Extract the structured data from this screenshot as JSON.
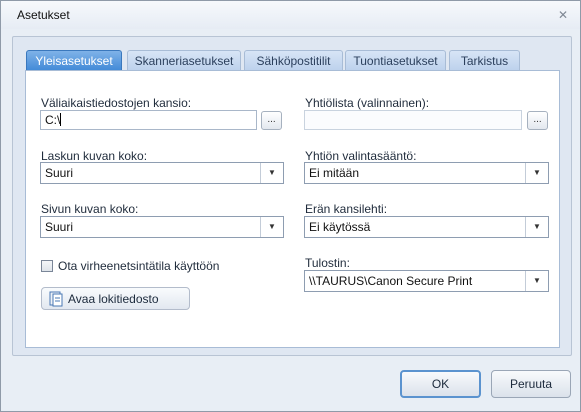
{
  "window": {
    "title": "Asetukset",
    "close_glyph": "✕"
  },
  "tabs": [
    {
      "label": "Yleisasetukset",
      "active": true
    },
    {
      "label": "Skanneriasetukset",
      "active": false
    },
    {
      "label": "Sähköpostitilit",
      "active": false
    },
    {
      "label": "Tuontiasetukset",
      "active": false
    },
    {
      "label": "Tarkistus",
      "active": false
    }
  ],
  "left": {
    "temp_folder_label": "Väliaikaistiedostojen kansio:",
    "temp_folder_value": "C:\\",
    "browse_label": "...",
    "invoice_image_size_label": "Laskun kuvan koko:",
    "invoice_image_size_value": "Suuri",
    "page_image_size_label": "Sivun kuvan koko:",
    "page_image_size_value": "Suuri",
    "debug_mode_label": "Ota virheenetsintätila käyttöön",
    "debug_mode_checked": false,
    "open_log_label": "Avaa lokitiedosto"
  },
  "right": {
    "company_list_label": "Yhtiölista (valinnainen):",
    "company_list_value": "",
    "browse_label": "...",
    "company_rule_label": "Yhtiön valintasääntö:",
    "company_rule_value": "Ei mitään",
    "batch_cover_label": "Erän kansilehti:",
    "batch_cover_value": "Ei käytössä",
    "printer_label": "Tulostin:",
    "printer_value": "\\\\TAURUS\\Canon Secure Print"
  },
  "buttons": {
    "ok": "OK",
    "cancel": "Peruuta"
  },
  "icons": {
    "dropdown": "chevron-down-icon",
    "log": "document-icon",
    "close": "close-icon"
  }
}
